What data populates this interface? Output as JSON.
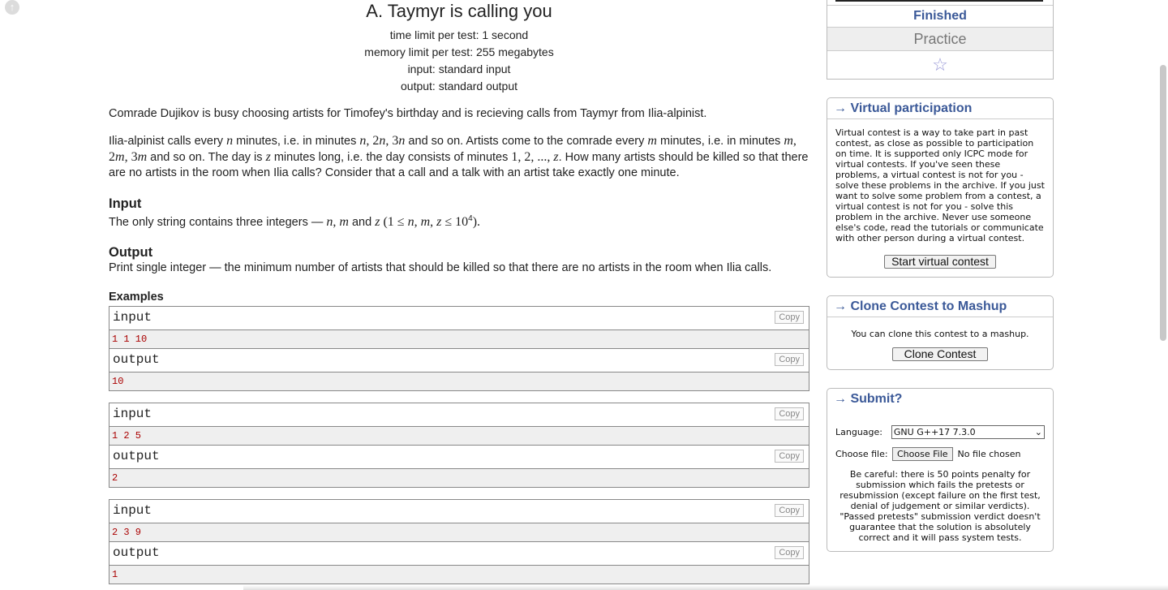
{
  "problem": {
    "title": "A. Taymyr is calling you",
    "time_limit": "time limit per test: 1 second",
    "memory_limit": "memory limit per test: 255 megabytes",
    "input_file": "input: standard input",
    "output_file": "output: standard output",
    "legend_1": "Comrade Dujikov is busy choosing artists for Timofey's birthday and is recieving calls from Taymyr from Ilia-alpinist.",
    "legend_2": {
      "a": "Ilia-alpinist calls every ",
      "b": " minutes, i.e. in minutes ",
      "c": " and so on. Artists come to the comrade every ",
      "d": " minutes, i.e. in minutes ",
      "e": " and so on. The day is ",
      "f": " minutes long, i.e. the day consists of minutes ",
      "g": ". How many artists should be killed so that there are no artists in the room when Ilia calls? Consider that a call and a talk with an artist take exactly one minute."
    },
    "input_title": "Input",
    "input_text_a": "The only string contains three integers — ",
    "input_text_b": " and ",
    "input_text_c": "(1 ≤ ",
    "input_text_d": " ≤ 10",
    "input_text_e": ").",
    "output_title": "Output",
    "output_text": "Print single integer — the minimum number of artists that should be killed so that there are no artists in the room when Ilia calls.",
    "examples_title": "Examples",
    "input_label": "input",
    "output_label": "output",
    "copy_label": "Copy",
    "samples": [
      {
        "input": "1 1 10",
        "output": "10"
      },
      {
        "input": "1 2 5",
        "output": "2"
      },
      {
        "input": "2 3 9",
        "output": "1"
      }
    ]
  },
  "sidebar": {
    "status": "Finished",
    "mode": "Practice",
    "star": "☆",
    "virtual": {
      "title": "→ Virtual participation",
      "text": "Virtual contest is a way to take part in past contest, as close as possible to participation on time. It is supported only ICPC mode for virtual contests. If you've seen these problems, a virtual contest is not for you - solve these problems in the archive. If you just want to solve some problem from a contest, a virtual contest is not for you - solve this problem in the archive. Never use someone else's code, read the tutorials or communicate with other person during a virtual contest.",
      "button": "Start virtual contest"
    },
    "clone": {
      "title": "→ Clone Contest to Mashup",
      "text": "You can clone this contest to a mashup.",
      "button": "Clone Contest"
    },
    "submit": {
      "title": "→ Submit?",
      "language_label": "Language:",
      "language_value": "GNU G++17 7.3.0",
      "file_label": "Choose file:",
      "file_button": "Choose File",
      "file_status": "No file chosen",
      "warning": "Be careful: there is 50 points penalty for submission which fails the pretests or resubmission (except failure on the first test, denial of judgement or similar verdicts). \"Passed pretests\" submission verdict doesn't guarantee that the solution is absolutely correct and it will pass system tests."
    }
  }
}
